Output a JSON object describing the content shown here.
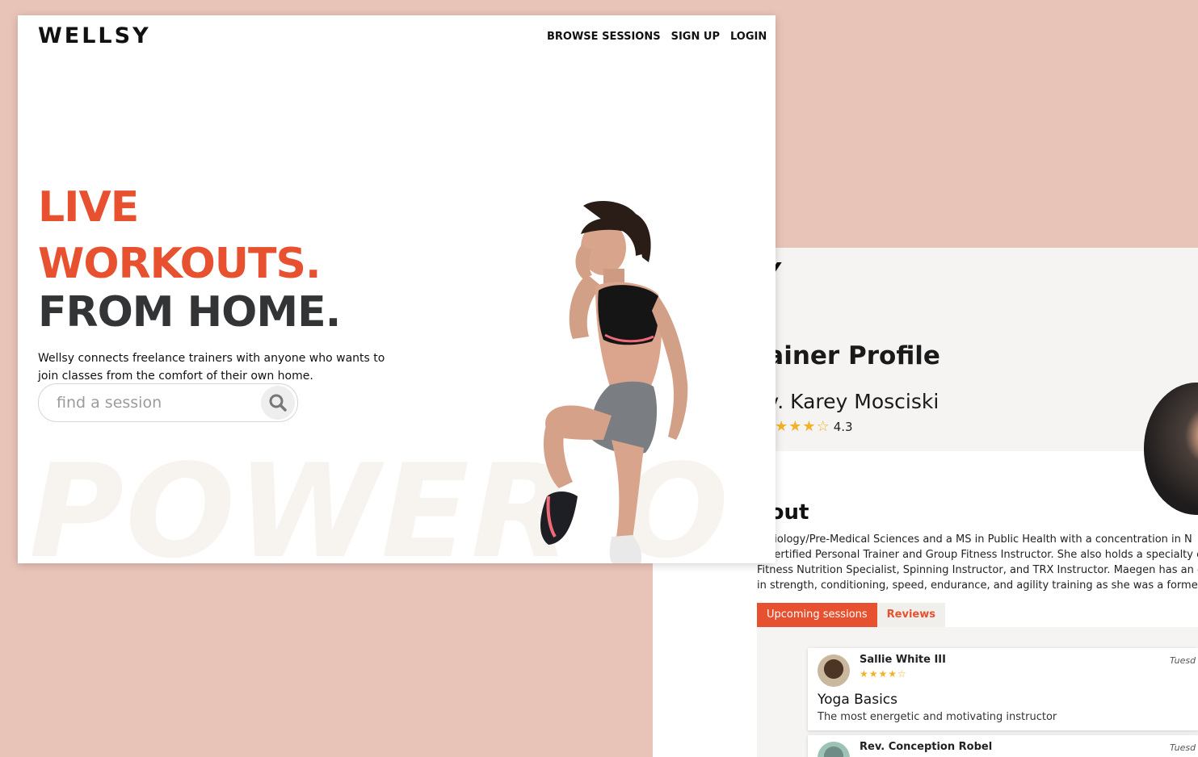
{
  "landing": {
    "logo": "WELLSY",
    "nav": [
      "BROWSE SESSIONS",
      "SIGN UP",
      "LOGIN"
    ],
    "hero": {
      "line1": "LIVE",
      "line2": "WORKOUTS.",
      "line3": "FROM HOME."
    },
    "tagline": "Wellsy connects freelance trainers with anyone who wants to join classes from the comfort of their own home.",
    "search": {
      "placeholder": "find a session",
      "icon": "search-icon"
    },
    "watermark": "POWER O",
    "colors": {
      "accent": "#e8512f",
      "dark": "#333436",
      "page_bg": "#e8c3b8"
    }
  },
  "profile": {
    "logo_partial": "SY",
    "page_title": "rainer Profile",
    "trainer_name": "ev. Karey Mosciski",
    "rating": {
      "value": "4.3",
      "stars": 4.3
    },
    "about_heading": "bout",
    "about_lines": [
      "n Biology/Pre-Medical Sciences and a MS in Public Health with a concentration in N",
      "E Certified Personal Trainer and Group Fitness Instructor. She also holds a specialty c",
      "Fitness Nutrition Specialist, Spinning Instructor, and TRX Instructor. Maegen has an ext",
      "in strength, conditioning, speed, endurance, and agility training as she was a former co"
    ],
    "tabs": [
      "Upcoming sessions",
      "Reviews"
    ],
    "reviews": [
      {
        "name": "Sallie White III",
        "stars": "★★★★☆",
        "date": "Tuesd",
        "session": "Yoga Basics",
        "comment": "The most energetic and motivating instructor"
      },
      {
        "name": "Rev. Conception Robel",
        "date": "Tuesd"
      }
    ]
  }
}
